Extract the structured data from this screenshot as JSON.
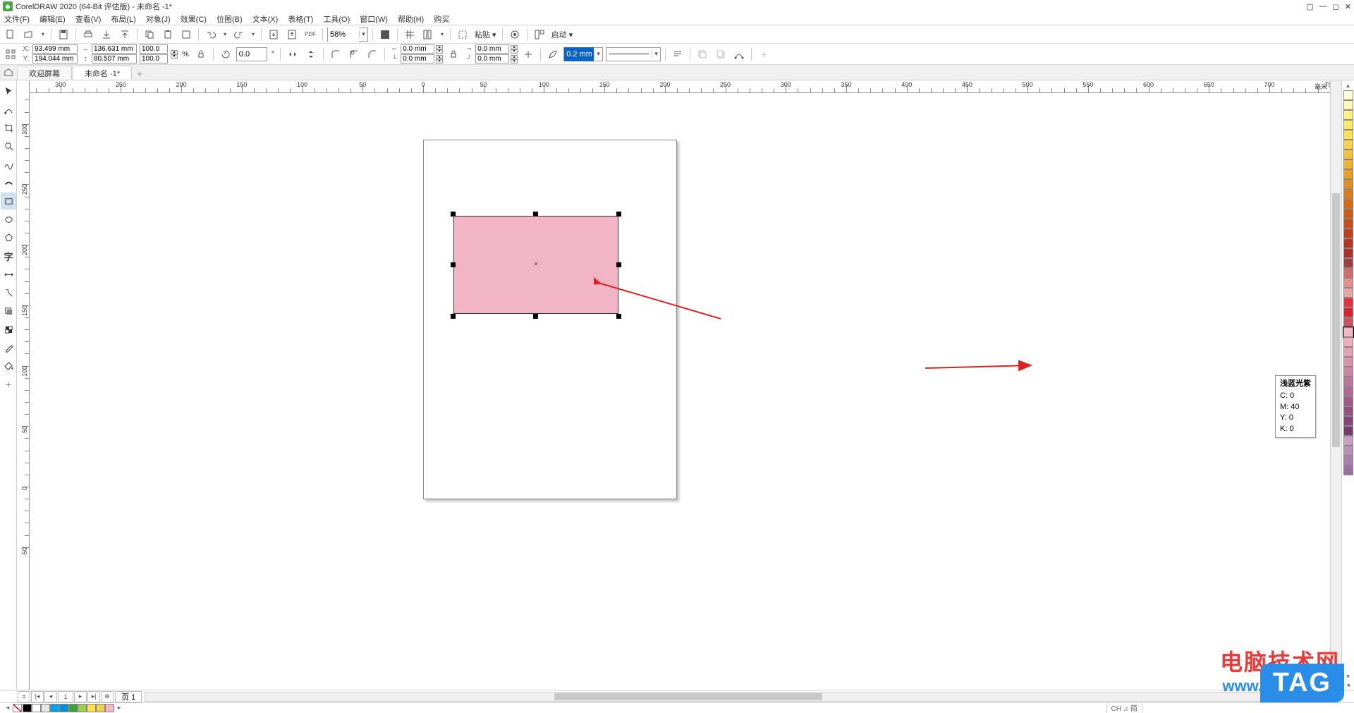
{
  "title": "CorelDRAW 2020 (64-Bit 评估版) - 未命名 -1*",
  "menus": [
    "文件(F)",
    "编辑(E)",
    "查看(V)",
    "布局(L)",
    "对象(J)",
    "效果(C)",
    "位图(B)",
    "文本(X)",
    "表格(T)",
    "工具(O)",
    "窗口(W)",
    "帮助(H)",
    "购买"
  ],
  "toolbar": {
    "zoom": "58%",
    "paste": "粘贴 ▾",
    "start": "启动 ▾"
  },
  "props": {
    "x": "93.499 mm",
    "y": "194.044 mm",
    "w": "136.631 mm",
    "h": "80.507 mm",
    "sx": "100.0",
    "sy": "100.0",
    "rot": "0.0",
    "corner1a": "0.0 mm",
    "corner1b": "0.0 mm",
    "corner2a": "0.0 mm",
    "corner2b": "0.0 mm",
    "outline": "0.2 mm"
  },
  "tabs": {
    "welcome": "欢迎屏幕",
    "doc": "未命名 -1*"
  },
  "ruler_unit": "毫米",
  "page_label": "页 1",
  "page_count": "1",
  "tooltip": {
    "name": "浅蓝光紫",
    "c": "C: 0",
    "m": "M: 40",
    "y": "Y: 0",
    "k": "K: 0"
  },
  "ime": "CH ♫ 简",
  "watermark": {
    "cn": "电脑技术网",
    "url": "www.tagxp.com",
    "tag": "TAG"
  },
  "palette_right": [
    "#fffcd9",
    "#fff9b8",
    "#fdf08a",
    "#fbe96b",
    "#fae158",
    "#f6d24a",
    "#f2c23d",
    "#eeb230",
    "#e89f26",
    "#e28d1f",
    "#dc7b1a",
    "#d66a17",
    "#cf5a16",
    "#c84d18",
    "#bf411c",
    "#b63721",
    "#ad2f28",
    "#9f4040",
    "#d16b6b",
    "#e58e8e",
    "#e6a6a6",
    "#e3333f",
    "#da2230",
    "#c8555f",
    "#f5b9c5",
    "#f0aebd",
    "#e6a1b5",
    "#d993ad",
    "#cb85a4",
    "#bd779b",
    "#af6992",
    "#a15b89",
    "#935080",
    "#854677",
    "#773c6e",
    "#c99fc5",
    "#ba8fb8",
    "#ab80ab",
    "#9c719e"
  ],
  "palette_bottom": [
    "#000000",
    "#ffffff",
    "#e6e6e6",
    "#00a3e8",
    "#008fd8",
    "#3aa63a",
    "#9fce4e",
    "#ffe04a",
    "#f0d24a",
    "#f5b9c5"
  ]
}
